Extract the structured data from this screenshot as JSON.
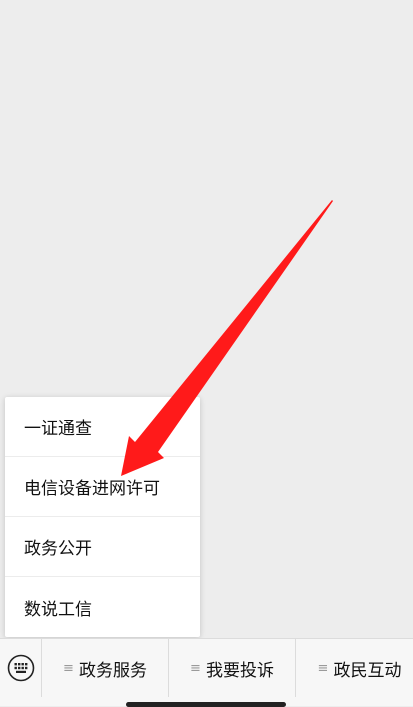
{
  "menu": {
    "items": [
      {
        "label": "一证通查"
      },
      {
        "label": "电信设备进网许可"
      },
      {
        "label": "政务公开"
      },
      {
        "label": "数说工信"
      }
    ]
  },
  "bottom_bar": {
    "keyboard_icon": "keyboard-icon",
    "tabs": [
      {
        "label": "政务服务",
        "icon": "menu-lines-icon"
      },
      {
        "label": "我要投诉",
        "icon": "menu-lines-icon"
      },
      {
        "label": "政民互动",
        "icon": "menu-lines-icon"
      }
    ]
  },
  "annotation": {
    "arrow_color": "#ff1a1a"
  }
}
